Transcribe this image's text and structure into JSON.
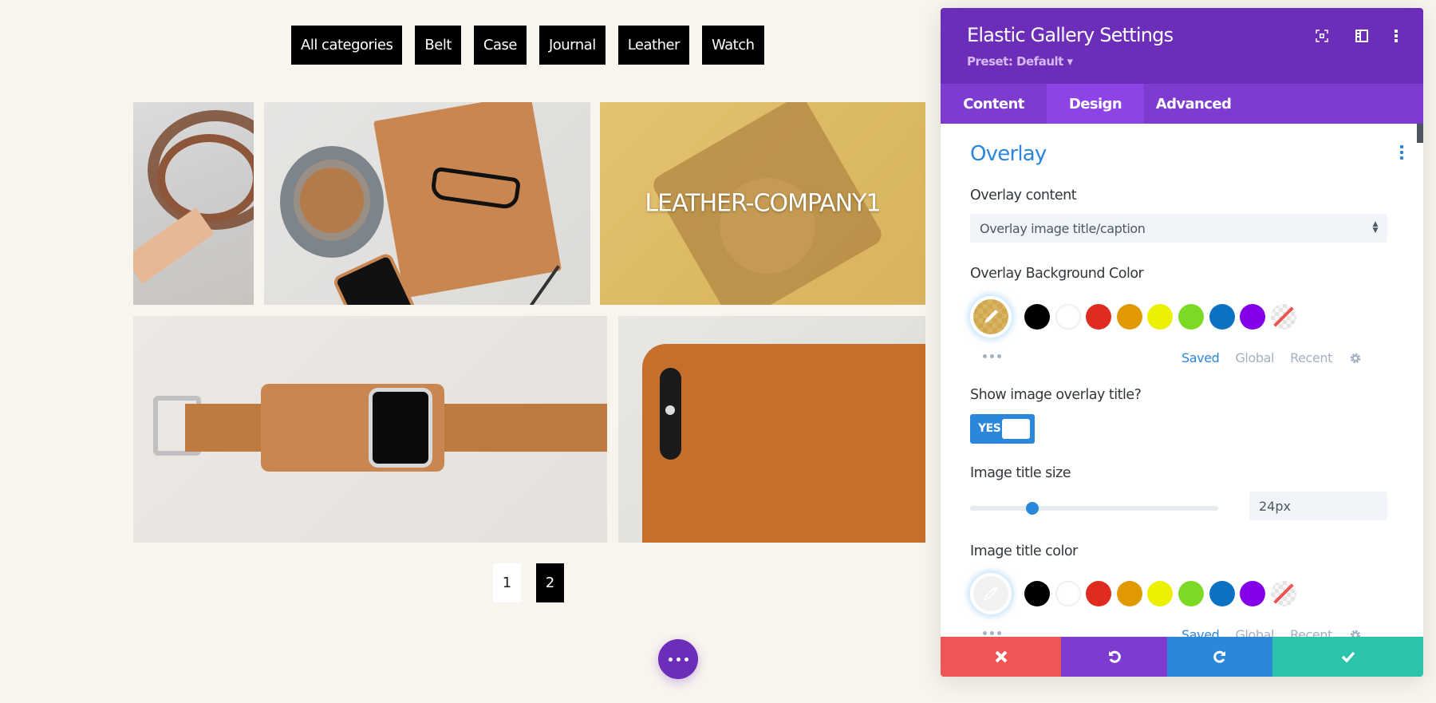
{
  "filters": {
    "items": [
      "All categories",
      "Belt",
      "Case",
      "Journal",
      "Leather",
      "Watch"
    ]
  },
  "gallery": {
    "images": [
      {
        "subject": "leather-cord-belt"
      },
      {
        "subject": "coffee-journal-glasses"
      },
      {
        "subject": "leather-camera-case",
        "overlay_title": "LEATHER-COMPANY1"
      },
      {
        "subject": "leather-watch-band"
      },
      {
        "subject": "leather-phone-case"
      }
    ]
  },
  "pagination": {
    "pages": [
      "1",
      "2"
    ],
    "current": "2"
  },
  "fab": {
    "icon": "more-horizontal-icon"
  },
  "panel": {
    "title": "Elastic Gallery Settings",
    "preset": "Preset: Default ▾",
    "header_icons": [
      "expand-icon",
      "sidebar-layout-icon",
      "more-vertical-icon"
    ],
    "tabs": [
      {
        "label": "Content",
        "active": false
      },
      {
        "label": "Design",
        "active": true
      },
      {
        "label": "Advanced",
        "active": false
      }
    ],
    "section": {
      "title": "Overlay",
      "overlay_content": {
        "label": "Overlay content",
        "value": "Overlay image title/caption"
      },
      "overlay_bg_color": {
        "label": "Overlay Background Color",
        "current": "#d9b460"
      },
      "show_title": {
        "label": "Show image overlay title?",
        "value": "YES"
      },
      "title_size": {
        "label": "Image title size",
        "value": "24px",
        "slider_fraction": 0.25
      },
      "title_color": {
        "label": "Image title color",
        "current": "#ffffff"
      }
    },
    "palette": {
      "swatches": [
        "#000000",
        "#ffffff",
        "#e02b20",
        "#e09900",
        "#edf000",
        "#7cda24",
        "#0c71c3",
        "#8300e9",
        "none"
      ],
      "tabs": [
        {
          "label": "Saved",
          "active": true
        },
        {
          "label": "Global",
          "active": false
        },
        {
          "label": "Recent",
          "active": false
        }
      ]
    },
    "footer": [
      {
        "action": "discard",
        "icon": "close-icon",
        "color": "#ef5555"
      },
      {
        "action": "undo",
        "icon": "undo-icon",
        "color": "#7e3bd0"
      },
      {
        "action": "redo",
        "icon": "redo-icon",
        "color": "#2b87da"
      },
      {
        "action": "save",
        "icon": "check-icon",
        "color": "#29c4a9"
      }
    ]
  },
  "colors": {
    "brand_purple": "#6c2eb9",
    "tab_bar": "#7e3bd0",
    "tab_active": "#8e43e7",
    "accent_blue": "#2b87da",
    "page_bg": "#f8f4ee"
  }
}
